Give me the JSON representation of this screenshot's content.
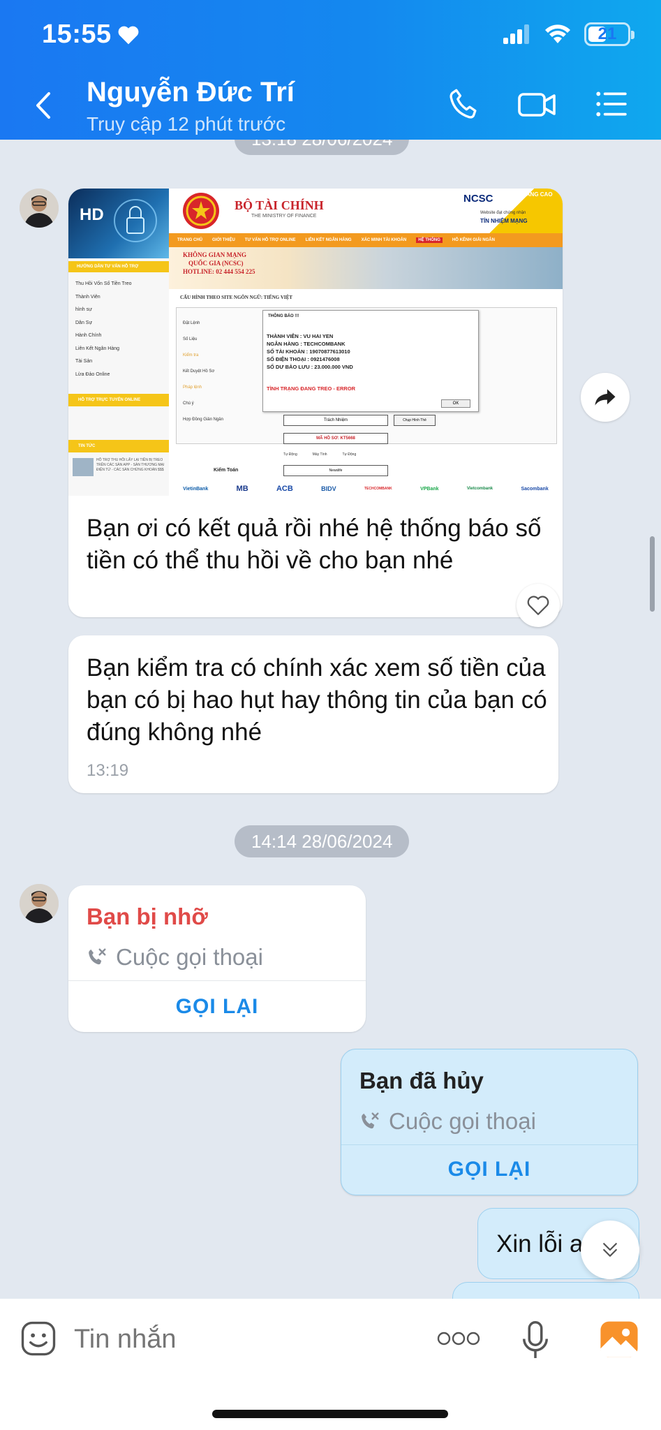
{
  "status_bar": {
    "time": "15:55",
    "battery": "21"
  },
  "header": {
    "contact_name": "Nguyễn Đức Trí",
    "last_seen": "Truy cập 12 phút trước"
  },
  "chat": {
    "time_top": "13:18 28/06/2024",
    "image_msg": {
      "hd_badge": "HD",
      "caption": "Bạn ơi có kết quả rồi nhé hệ thống báo số tiền có thể thu hồi về cho bạn nhé"
    },
    "text_msg": {
      "text": "Bạn kiểm tra có chính xác xem số tiền của bạn có bị hao hụt hay thông tin của bạn có đúng không nhé",
      "time": "13:19"
    },
    "time_mid": "14:14 28/06/2024",
    "missed_call": {
      "title": "Bạn bị nhỡ",
      "subtitle": "Cuộc gọi thoại",
      "button": "GỌI LẠI"
    },
    "cancelled_call": {
      "title": "Bạn đã hủy",
      "subtitle": "Cuộc gọi thoại",
      "button": "GỌI LẠI"
    },
    "partial_msg": "Xin lỗi a"
  },
  "screenshot": {
    "ministry": "BỘ TÀI CHÍNH",
    "ministry_en": "THE MINISTRY OF FINANCE",
    "ncsc_brand": "NCSC",
    "ncsc_badge": "NÂNG CAO",
    "ncsc_text1": "Website đạt chứng nhận",
    "ncsc_text2": "TÍN NHIỆM MẠNG",
    "nav": [
      "TRANG CHỦ",
      "GIỚI THIỆU",
      "TƯ VẤN HỖ TRỢ ONLINE",
      "LIÊN KẾT NGÂN HÀNG",
      "XÁC MINH TÀI KHOẢN",
      "HỆ THỐNG",
      "HỖ KÊNH GIẢI NGÂN"
    ],
    "side_title": "HƯỚNG DẪN TƯ VẤN HỖ TRỢ",
    "side_items": [
      "Thu Hồi Vốn Số Tiền Treo",
      "Thành Viên",
      "hình sự",
      "Dân Sự",
      "Hành Chính",
      "Liên Kết Ngân Hàng",
      "Tài Sản",
      "Lừa Đảo Online"
    ],
    "side_title2": "HỖ TRỢ TRỰC TUYẾN ONLINE",
    "side_title3": "TIN TỨC",
    "side_news": "HỖ TRỢ THU HỒI LẤY LẠI TIỀN BỊ TREO TRÊN CÁC SÀN APP - SÀN THƯƠNG MẠI ĐIỆN TỬ - CÁC SÀN CHỨNG KHOÁN $$$",
    "banner1": "KHÔNG GIAN MẠNG",
    "banner2": "QUỐC GIA (NCSC)",
    "banner3": "HOTLINE: 02 444 554 225",
    "config": "CẤU HÌNH THEO SITE NGÔN NGỮ: TIẾNG VIỆT",
    "rows": [
      "Đặt Lệnh",
      "Số Liệu",
      "Kiểm tra",
      "Kết Duyệt Hồ Sơ",
      "Pháp lệnh",
      "Chú ý",
      "Hợp Đồng Giản Ngân"
    ],
    "dialog_title": "THÔNG BÁO !!!",
    "dialog_lines": [
      "THÀNH VIÊN : VU HAI YEN",
      "NGÂN HÀNG : TECHCOMBANK",
      "SỐ TÀI KHOẢN : 19070877613010",
      "SỐ ĐIỆN THOẠI : 0921476008",
      "SỐ DƯ BẢO LƯU : 23.000.000 VND"
    ],
    "dialog_status": "TÌNH TRẠNG ĐANG TREO - ERROR",
    "dialog_ok": "OK",
    "field_resp": "Trách Nhiệm",
    "field_photo": "Chụp Hình Thẻ",
    "file_no": "MÃ HỒ SƠ: KT5668",
    "checks": [
      "Tự Động",
      "Máy Tính",
      "Tự Động"
    ],
    "audit_label": "Kiểm Toán",
    "audit_value": "Newslife",
    "banks": [
      "VietinBank",
      "MB",
      "ACB",
      "BIDV",
      "TECHCOMBANK",
      "VPBank",
      "Vietcombank",
      "Sacombank"
    ]
  },
  "compose": {
    "placeholder": "Tin nhắn"
  },
  "colors": {
    "header": "#1a78f2",
    "missed": "#e04a48",
    "action": "#1a8ae8",
    "sent_bg": "#d3ecfb"
  }
}
